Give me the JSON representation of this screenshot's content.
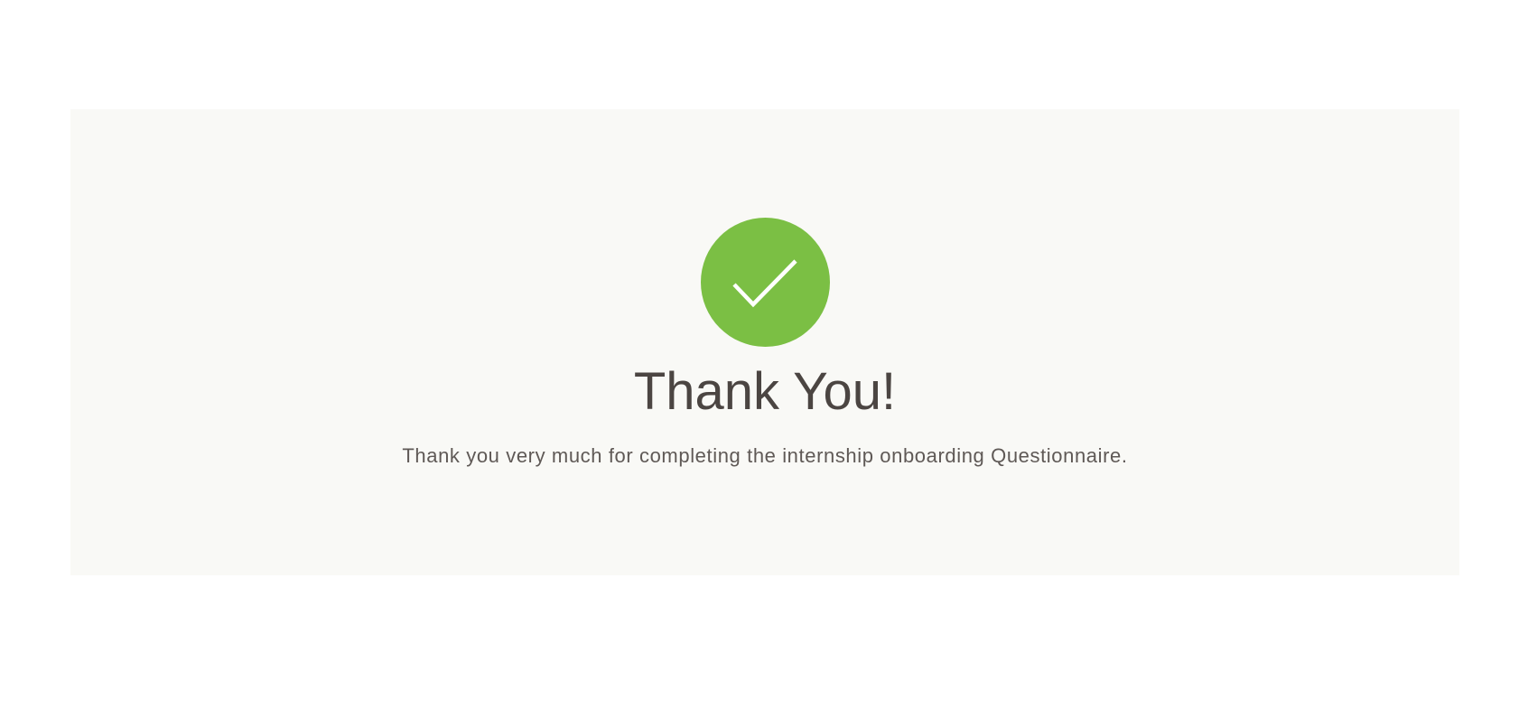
{
  "confirmation": {
    "icon": "checkmark-icon",
    "icon_color": "#7bbf44",
    "title": "Thank You!",
    "message": "Thank you very much for completing the internship onboarding Questionnaire."
  },
  "colors": {
    "card_background": "#f9f9f6",
    "text_dark": "#4b4542",
    "text_muted": "#5f5956"
  }
}
